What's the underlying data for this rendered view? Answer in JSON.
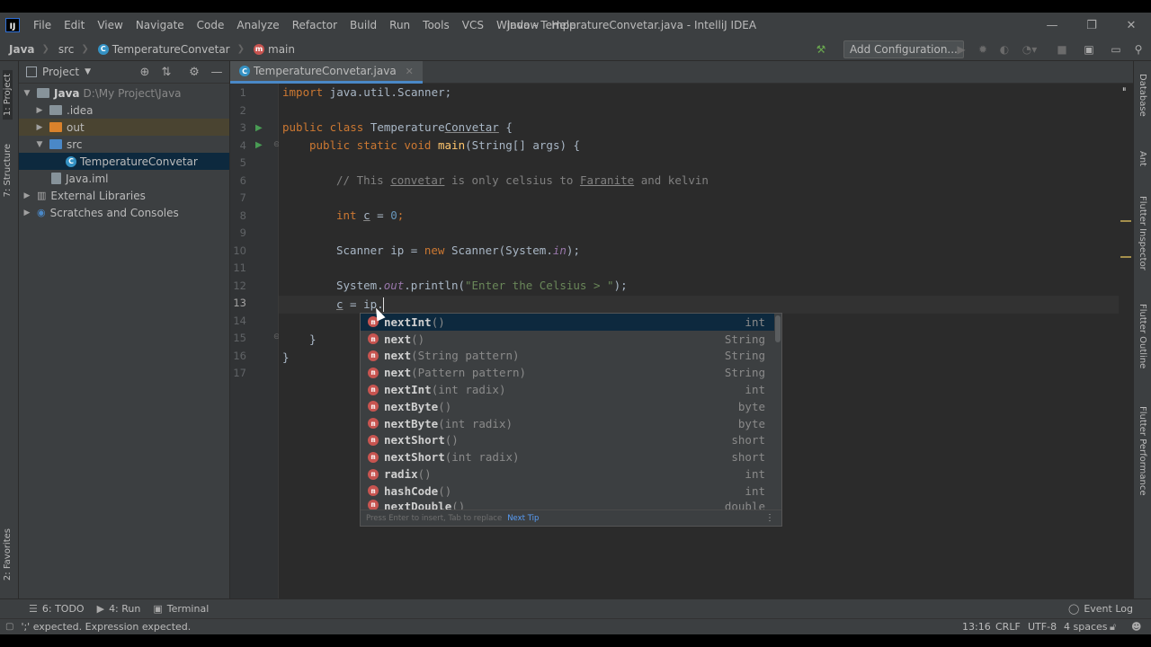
{
  "window": {
    "logo": "IJ",
    "title": "Java - TemperatureConvetar.java - IntelliJ IDEA",
    "menu": [
      "File",
      "Edit",
      "View",
      "Navigate",
      "Code",
      "Analyze",
      "Refactor",
      "Build",
      "Run",
      "Tools",
      "VCS",
      "Window",
      "Help"
    ],
    "controls": {
      "minimize": "—",
      "maximize": "❐",
      "close": "✕"
    }
  },
  "navbar": {
    "crumbs": [
      "Java",
      "src",
      "TemperatureConvetar",
      "main"
    ],
    "add_config": "Add Configuration..."
  },
  "left_tabs": {
    "project": "1: Project",
    "structure": "7: Structure",
    "favorites": "2: Favorites"
  },
  "right_tabs": [
    "Database",
    "Ant",
    "Flutter Inspector",
    "Flutter Outline",
    "Flutter Performance"
  ],
  "project": {
    "header": "Project",
    "tree": [
      {
        "label": "Java",
        "extra": "D:\\My Project\\Java"
      },
      {
        "label": ".idea"
      },
      {
        "label": "out"
      },
      {
        "label": "src"
      },
      {
        "label": "TemperatureConvetar"
      },
      {
        "label": "Java.iml"
      },
      {
        "label": "External Libraries"
      },
      {
        "label": "Scratches and Consoles"
      }
    ]
  },
  "editor": {
    "tab": "TemperatureConvetar.java",
    "line_numbers": [
      "1",
      "2",
      "3",
      "4",
      "5",
      "6",
      "7",
      "8",
      "9",
      "10",
      "11",
      "12",
      "13",
      "14",
      "15",
      "16",
      "17"
    ],
    "code": {
      "l1_kw": "import",
      "l1_rest": " java.util.Scanner;",
      "l3_kw": "public class",
      "l3_a": " Temperature",
      "l3_b": "Convetar",
      "l3_c": " {",
      "l4_kw": "public static void",
      "l4_fn": "main",
      "l4_rest": "(String[] args) {",
      "l6_a": "// This ",
      "l6_b": "convetar",
      "l6_c": " is only celsius to ",
      "l6_d": "Faranite",
      "l6_e": " and kelvin",
      "l8_kw": "int",
      "l8_var": "c",
      "l8_eq": " = ",
      "l8_num": "0",
      "l8_end": ";",
      "l10_a": "Scanner ",
      "l10_var": "ip",
      "l10_eq": " = ",
      "l10_kw": "new",
      "l10_b": " Scanner(System.",
      "l10_fld": "in",
      "l10_c": ");",
      "l12_a": "System.",
      "l12_fld": "out",
      "l12_b": ".println(",
      "l12_str": "\"Enter the Celsius > \"",
      "l12_c": ");",
      "l13_var": "c",
      "l13_eq": " = ",
      "l13_ip": "ip",
      "l13_dot": ".",
      "l15": "}",
      "l16": "}"
    }
  },
  "completion": {
    "items": [
      {
        "name": "nextInt",
        "params": "()",
        "type": "int"
      },
      {
        "name": "next",
        "params": "()",
        "type": "String"
      },
      {
        "name": "next",
        "params": "(String pattern)",
        "type": "String"
      },
      {
        "name": "next",
        "params": "(Pattern pattern)",
        "type": "String"
      },
      {
        "name": "nextInt",
        "params": "(int radix)",
        "type": "int"
      },
      {
        "name": "nextByte",
        "params": "()",
        "type": "byte"
      },
      {
        "name": "nextByte",
        "params": "(int radix)",
        "type": "byte"
      },
      {
        "name": "nextShort",
        "params": "()",
        "type": "short"
      },
      {
        "name": "nextShort",
        "params": "(int radix)",
        "type": "short"
      },
      {
        "name": "radix",
        "params": "()",
        "type": "int"
      },
      {
        "name": "hashCode",
        "params": "()",
        "type": "int"
      },
      {
        "name": "nextDouble",
        "params": "()",
        "type": "double"
      }
    ],
    "footer": "Press Enter to insert, Tab to replace",
    "tip": "Next Tip"
  },
  "bottom_tools": {
    "todo": "6: TODO",
    "run": "4: Run",
    "terminal": "Terminal",
    "event_log": "Event Log"
  },
  "status": {
    "message": "';' expected. Expression expected.",
    "position": "13:16",
    "line_sep": "CRLF",
    "encoding": "UTF-8",
    "indent": "4 spaces"
  },
  "colors": {
    "accent": "#4a88c7",
    "keyword": "#cc7832",
    "string": "#6a8759",
    "number": "#6897bb",
    "method_icon": "#c75450",
    "class_icon": "#3592c4"
  }
}
